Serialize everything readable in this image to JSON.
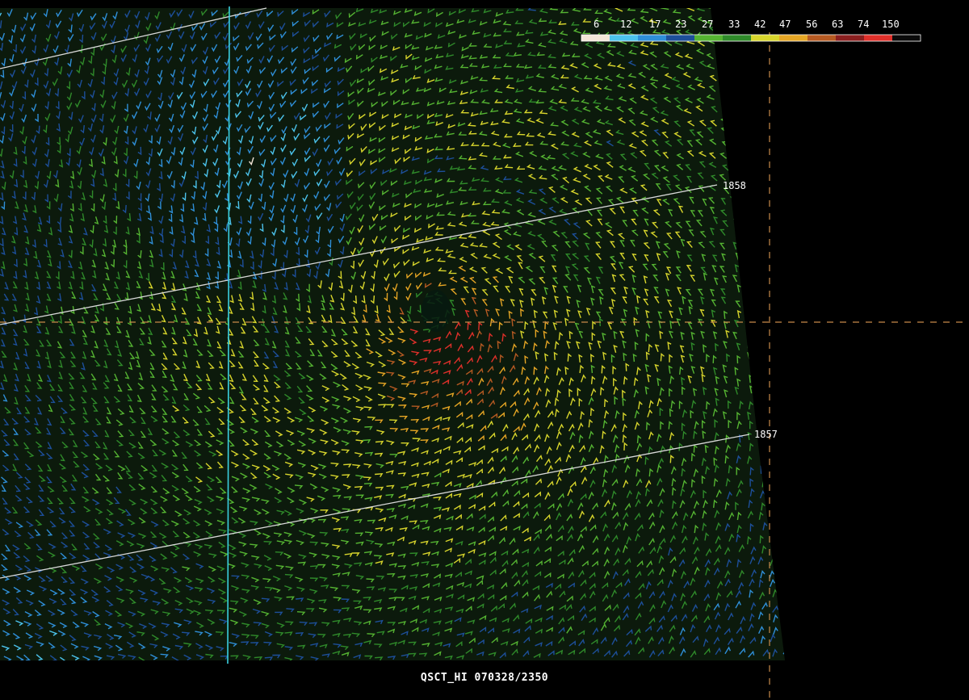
{
  "legend": {
    "labels": [
      "6",
      "12",
      "17",
      "23",
      "27",
      "33",
      "42",
      "47",
      "56",
      "63",
      "74",
      "150"
    ],
    "colors": [
      "#f3e6d8",
      "#4cc3ec",
      "#2f8fd8",
      "#1d4f9a",
      "#55b432",
      "#2f8a2a",
      "#d7d52c",
      "#e6a624",
      "#b65a22",
      "#8a1f1f",
      "#e0302a",
      "#0a0a0a"
    ]
  },
  "track_labels": {
    "upper": "1858",
    "lower": "1857"
  },
  "caption": "QSCT_HI 070328/2350",
  "colors": {
    "background": "#000000",
    "track_line": "#d9d9d9",
    "meridian_line": "#3ad0e0",
    "crosshair": "#c88a4a"
  }
}
